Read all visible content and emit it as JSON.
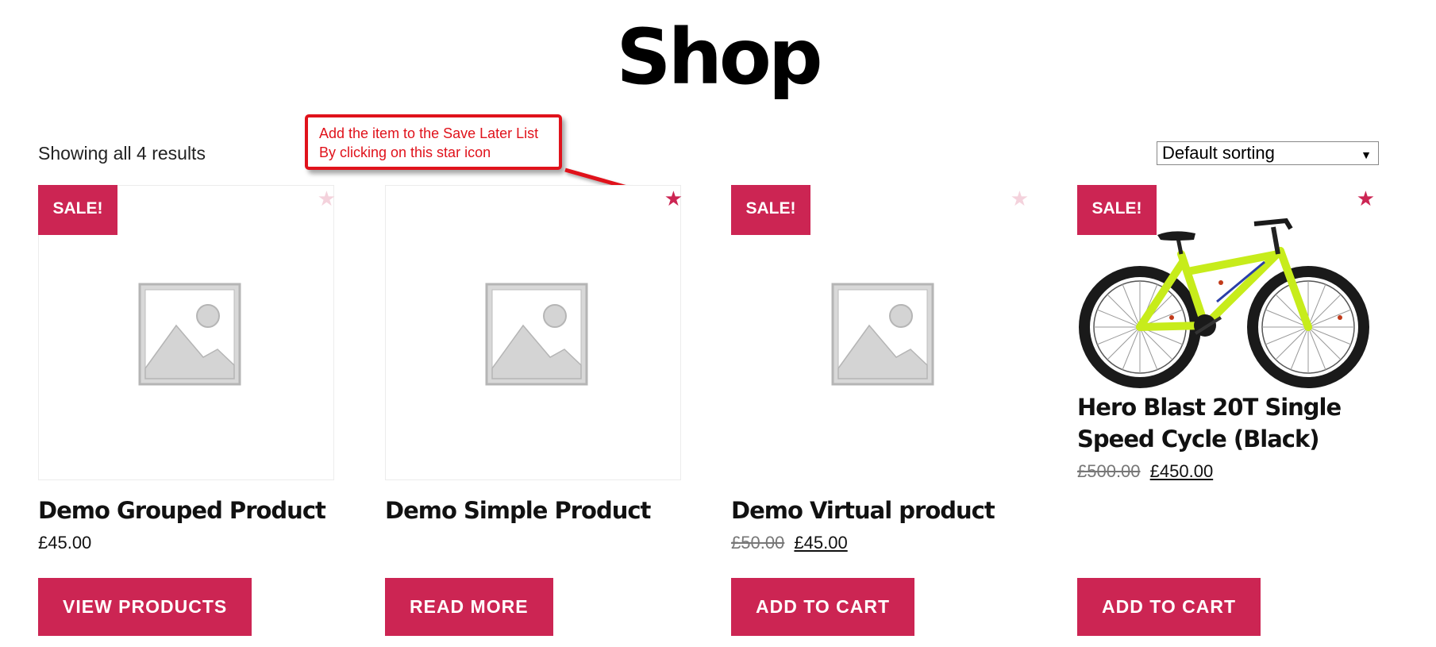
{
  "page": {
    "title": "Shop"
  },
  "toolbar": {
    "result_count": "Showing all 4 results",
    "sorting": {
      "selected": "Default sorting",
      "caret_icon": "chevron-down-icon"
    }
  },
  "callout": {
    "line1": "Add the item to the Save Later List",
    "line2": "By clicking on this star icon",
    "color": "#e0121b"
  },
  "theme": {
    "accent": "#cc2553",
    "star_inactive": "#f4d2dc"
  },
  "products": [
    {
      "name": "Demo Grouped Product",
      "sale_badge": "SALE!",
      "price": "£45.00",
      "button": "VIEW PRODUCTS",
      "saved": false,
      "image": "placeholder-image"
    },
    {
      "name": "Demo Simple Product",
      "price": "",
      "button": "READ MORE",
      "saved": true,
      "image": "placeholder-image"
    },
    {
      "name": "Demo Virtual product",
      "sale_badge": "SALE!",
      "regular_price": "£50.00",
      "sale_price": "£45.00",
      "button": "ADD TO CART",
      "saved": false,
      "image": "placeholder-image"
    },
    {
      "name": "Hero Blast 20T Single Speed Cycle (Black)",
      "sale_badge": "SALE!",
      "regular_price": "£500.00",
      "sale_price": "£450.00",
      "button": "ADD TO CART",
      "saved": true,
      "image": "bicycle-photo"
    }
  ]
}
